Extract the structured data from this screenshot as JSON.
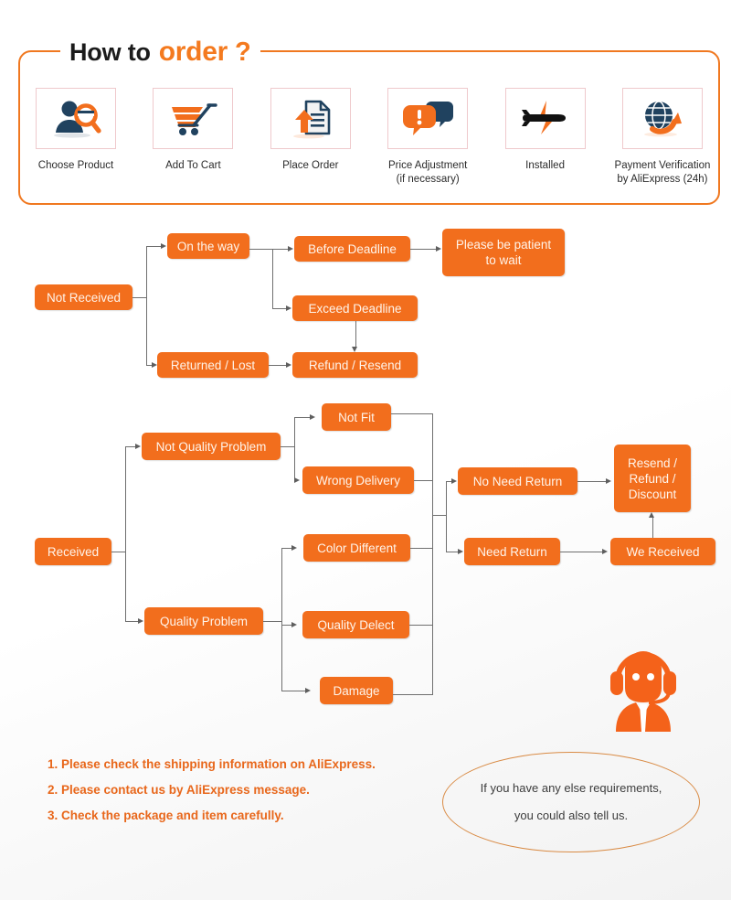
{
  "header": {
    "title_part1": "How to",
    "title_part2": "order",
    "title_part3": "?"
  },
  "steps": [
    {
      "label": "Choose Product",
      "icon": "person-search-icon"
    },
    {
      "label": "Add To Cart",
      "icon": "shopping-cart-icon"
    },
    {
      "label": "Place Order",
      "icon": "document-upload-icon"
    },
    {
      "label": "Price Adjustment\n(if necessary)",
      "icon": "speech-bubbles-alert-icon"
    },
    {
      "label": "Installed",
      "icon": "airplane-icon"
    },
    {
      "label": "Payment Verification\nby AliExpress (24h)",
      "icon": "globe-arrow-icon"
    }
  ],
  "flow_not_received": {
    "root": "Not Received",
    "on_the_way": "On the way",
    "returned_lost": "Returned / Lost",
    "before_deadline": "Before Deadline",
    "exceed_deadline": "Exceed Deadline",
    "refund_resend": "Refund / Resend",
    "please_wait": "Please be patient\nto wait"
  },
  "flow_received": {
    "root": "Received",
    "not_quality_problem": "Not Quality Problem",
    "quality_problem": "Quality Problem",
    "not_fit": "Not Fit",
    "wrong_delivery": "Wrong Delivery",
    "color_different": "Color Different",
    "quality_delect": "Quality Delect",
    "damage": "Damage",
    "no_need_return": "No Need Return",
    "need_return": "Need Return",
    "we_received": "We Received",
    "resend_refund_discount": "Resend /\nRefund /\nDiscount"
  },
  "notes": [
    "1. Please check the shipping information on AliExpress.",
    "2. Please contact us by AliExpress message.",
    "3. Check the package and item carefully."
  ],
  "bubble": {
    "line1": "If you have any else requirements,",
    "line2": "you could also tell us."
  },
  "colors": {
    "orange_box": "#F26E1D",
    "frame_orange": "#F07820",
    "note_orange": "#E8671B",
    "icon_border_pink": "#EFC9CC",
    "connector_gray": "#6f6f6f",
    "dark_navy": "#20425F",
    "bubble_border": "#D98B45"
  }
}
